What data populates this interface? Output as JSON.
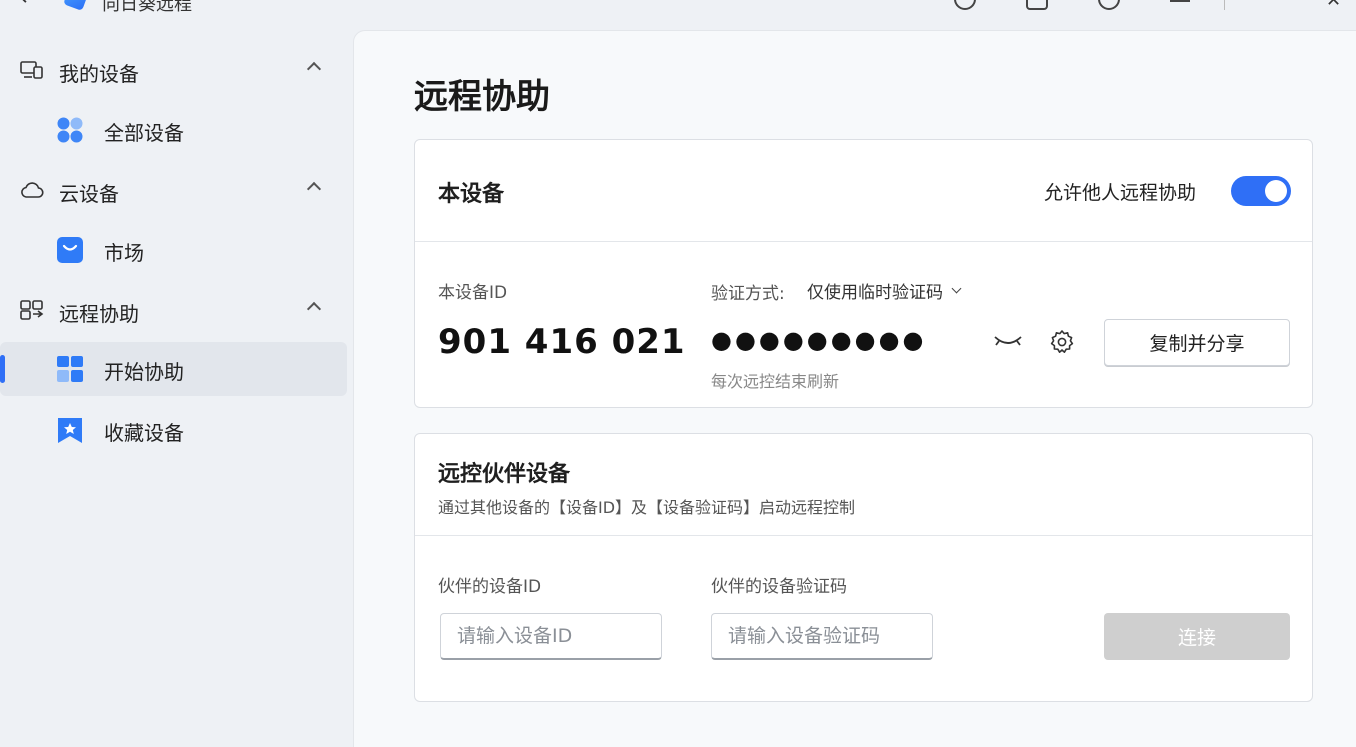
{
  "app": {
    "title": "向日葵远程"
  },
  "sidebar": {
    "groups": [
      {
        "label": "我的设备",
        "items": [
          {
            "label": "全部设备"
          }
        ]
      },
      {
        "label": "云设备",
        "items": [
          {
            "label": "市场"
          }
        ]
      },
      {
        "label": "远程协助",
        "items": [
          {
            "label": "开始协助",
            "active": true
          },
          {
            "label": "收藏设备"
          }
        ]
      }
    ]
  },
  "main": {
    "title": "远程协助",
    "this_device": {
      "title": "本设备",
      "allow_label": "允许他人远程协助",
      "allow_enabled": true,
      "id_label": "本设备ID",
      "id_value": "901 416 021",
      "verify_label": "验证方式:",
      "verify_value": "仅使用临时验证码",
      "code_mask": "●●●●●●●●●",
      "refresh_note": "每次远控结束刷新",
      "share_button": "复制并分享"
    },
    "partner": {
      "title": "远控伙伴设备",
      "subtitle": "通过其他设备的【设备ID】及【设备验证码】启动远程控制",
      "id_label": "伙伴的设备ID",
      "id_placeholder": "请输入设备ID",
      "code_label": "伙伴的设备验证码",
      "code_placeholder": "请输入设备验证码",
      "connect_button": "连接"
    }
  },
  "colors": {
    "accent": "#2f6ff6",
    "disabled_button": "#cfcfcf"
  },
  "icons": {
    "titlebar": [
      "back-arrow-icon",
      "app-logo-icon",
      "help-icon",
      "bell-icon",
      "info-icon",
      "menu-icon",
      "close-icon"
    ],
    "sidebar": [
      "devices-icon",
      "all-devices-icon",
      "cloud-icon",
      "market-bag-icon",
      "remote-assist-icon",
      "start-assist-icon",
      "favorite-star-icon"
    ],
    "main": [
      "eye-closed-icon",
      "gear-icon"
    ]
  }
}
